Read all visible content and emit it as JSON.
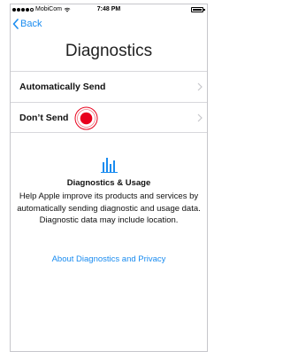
{
  "status_bar": {
    "carrier": "MobiCom",
    "time": "7:48 PM",
    "signal_bars_filled": 4,
    "signal_bars_total": 5,
    "battery_level": 1.0,
    "wifi_icon": "wifi-icon"
  },
  "nav": {
    "back_label": "Back",
    "back_icon": "chevron-left-icon"
  },
  "page": {
    "title": "Diagnostics"
  },
  "options": [
    {
      "label": "Automatically Send",
      "chevron_icon": "chevron-right-icon"
    },
    {
      "label": "Don’t Send",
      "chevron_icon": "chevron-right-icon"
    }
  ],
  "info": {
    "icon": "bar-chart-icon",
    "title": "Diagnostics & Usage",
    "body": "Help Apple improve its products and services by automatically sending diagnostic and usage data. Diagnostic data may include location.",
    "link": "About Diagnostics and Privacy"
  },
  "colors": {
    "accent": "#1a8cf0",
    "tap_indicator": "#e8001c",
    "separator": "#d8d8dc"
  }
}
